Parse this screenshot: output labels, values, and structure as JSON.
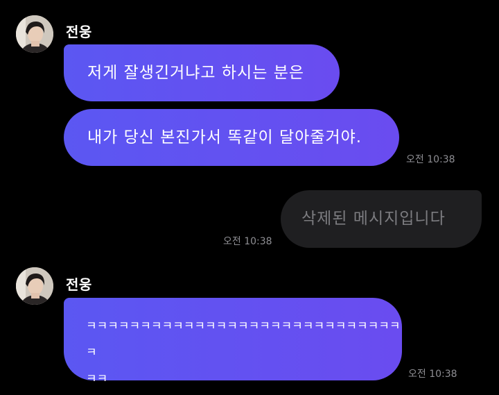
{
  "messages": [
    {
      "sender": "전웅",
      "lines": [
        "저게 잘생긴거냐고 하시는 분은"
      ]
    },
    {
      "lines": [
        "내가 당신 본진가서 똑같이 달아줄거야."
      ],
      "time": "오전 10:38"
    },
    {
      "outgoing": true,
      "lines": [
        "삭제된 메시지입니다"
      ],
      "time": "오전 10:38"
    },
    {
      "sender": "전웅",
      "lines": [
        "ㅋㅋㅋㅋㅋㅋㅋㅋㅋㅋㅋㅋㅋㅋㅋㅋㅋㅋㅋㅋㅋㅋㅋㅋㅋㅋㅋㅋㅋㅋ",
        "ㅋㅋ"
      ],
      "time": "오전 10:38"
    }
  ],
  "colors": {
    "incoming_bubble": "#5b57f2",
    "outgoing_bubble": "#1f1f21",
    "deleted_text": "#7c7c80",
    "background": "#000000"
  }
}
